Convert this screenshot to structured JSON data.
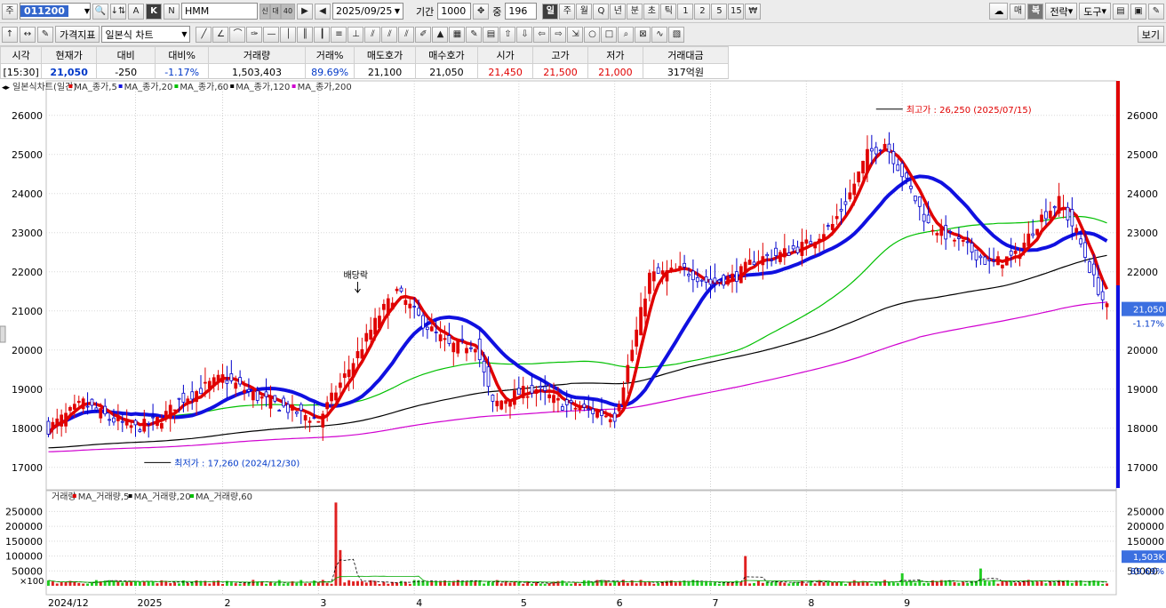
{
  "toolbar1": {
    "market_label": "주",
    "code": "011200",
    "name": "HMM",
    "sub_labels": [
      "신",
      "대",
      "40"
    ],
    "mode_buttons": [
      "A",
      "K",
      "N"
    ],
    "date": "2025/09/25",
    "period_label": "기간",
    "period": "1000",
    "count_label": "중",
    "count": "196",
    "intervals": [
      "일",
      "주",
      "월",
      "Q",
      "년",
      "분",
      "초",
      "틱",
      "1",
      "2",
      "5",
      "15",
      "₩"
    ],
    "right_buttons": [
      "매",
      "복",
      "전략",
      "도구"
    ]
  },
  "toolbar2": {
    "price_indicator": "가격지표",
    "chart_type": "일본식 차트",
    "view_label": "보기"
  },
  "quote": {
    "headers": [
      "시각",
      "현재가",
      "대비",
      "대비%",
      "거래량",
      "거래%",
      "매도호가",
      "매수호가",
      "시가",
      "고가",
      "저가",
      "거래대금"
    ],
    "values": [
      "[15:30]",
      "21,050",
      "-250",
      "-1.17%",
      "1,503,403",
      "89.69%",
      "21,100",
      "21,050",
      "21,450",
      "21,500",
      "21,000",
      "317억원"
    ]
  },
  "legend": {
    "price": [
      "일본식차트(일간)",
      "MA_종가,5",
      "MA_종가,20",
      "MA_종가,60",
      "MA_종가,120",
      "MA_종가,200"
    ],
    "volume": [
      "거래량",
      "MA_거래량,5",
      "MA_거래량,20",
      "MA_거래량,60"
    ]
  },
  "annotations": {
    "high": "최고가 : 26,250 (2025/07/15)",
    "low": "최저가 : 17,260 (2024/12/30)",
    "dividend": "배당락"
  },
  "price_tag": {
    "price": "21,050",
    "change": "-1.17%"
  },
  "volume_tag": {
    "volume": "1,503K",
    "pct": "89.69%",
    "unit": "×100"
  },
  "colors": {
    "up": "#e00000",
    "down": "#0000cc",
    "ma5": "#e00000",
    "ma20": "#1010e0",
    "ma60": "#00c000",
    "ma120": "#000000",
    "ma200": "#d000d0"
  },
  "chart_data": {
    "type": "candlestick",
    "price_axis": {
      "min": 17000,
      "max": 26000,
      "ticks": [
        17000,
        18000,
        19000,
        20000,
        21000,
        22000,
        23000,
        24000,
        25000,
        26000
      ]
    },
    "volume_axis": {
      "ticks": [
        50000,
        100000,
        150000,
        200000,
        250000
      ]
    },
    "x_labels": [
      "2024/12",
      "2025",
      "2",
      "3",
      "4",
      "5",
      "6",
      "7",
      "8",
      "9"
    ],
    "anchors": [
      [
        0,
        18000
      ],
      [
        8,
        18650
      ],
      [
        14,
        18250
      ],
      [
        20,
        18000
      ],
      [
        26,
        18250
      ],
      [
        30,
        18700
      ],
      [
        40,
        19300
      ],
      [
        48,
        18800
      ],
      [
        56,
        18450
      ],
      [
        62,
        18200
      ],
      [
        70,
        19700
      ],
      [
        76,
        20900
      ],
      [
        80,
        21500
      ],
      [
        86,
        20700
      ],
      [
        92,
        20100
      ],
      [
        98,
        20150
      ],
      [
        102,
        18600
      ],
      [
        108,
        18900
      ],
      [
        112,
        19000
      ],
      [
        118,
        18600
      ],
      [
        126,
        18400
      ],
      [
        130,
        18300
      ],
      [
        134,
        20000
      ],
      [
        138,
        21900
      ],
      [
        146,
        22050
      ],
      [
        152,
        21700
      ],
      [
        158,
        21900
      ],
      [
        162,
        22300
      ],
      [
        168,
        22450
      ],
      [
        174,
        22700
      ],
      [
        180,
        23200
      ],
      [
        184,
        24000
      ],
      [
        188,
        25000
      ],
      [
        192,
        25300
      ],
      [
        196,
        24500
      ],
      [
        202,
        23200
      ],
      [
        210,
        22700
      ],
      [
        216,
        22200
      ],
      [
        222,
        22400
      ],
      [
        228,
        23400
      ],
      [
        232,
        23800
      ],
      [
        236,
        23000
      ],
      [
        240,
        21800
      ],
      [
        243,
        21050
      ]
    ],
    "volume_events": [
      {
        "i": 66,
        "v": 280000
      },
      {
        "i": 67,
        "v": 120000
      },
      {
        "i": 160,
        "v": 100000
      },
      {
        "i": 196,
        "v": 42000
      },
      {
        "i": 214,
        "v": 58000
      }
    ],
    "candle_count": 244
  }
}
